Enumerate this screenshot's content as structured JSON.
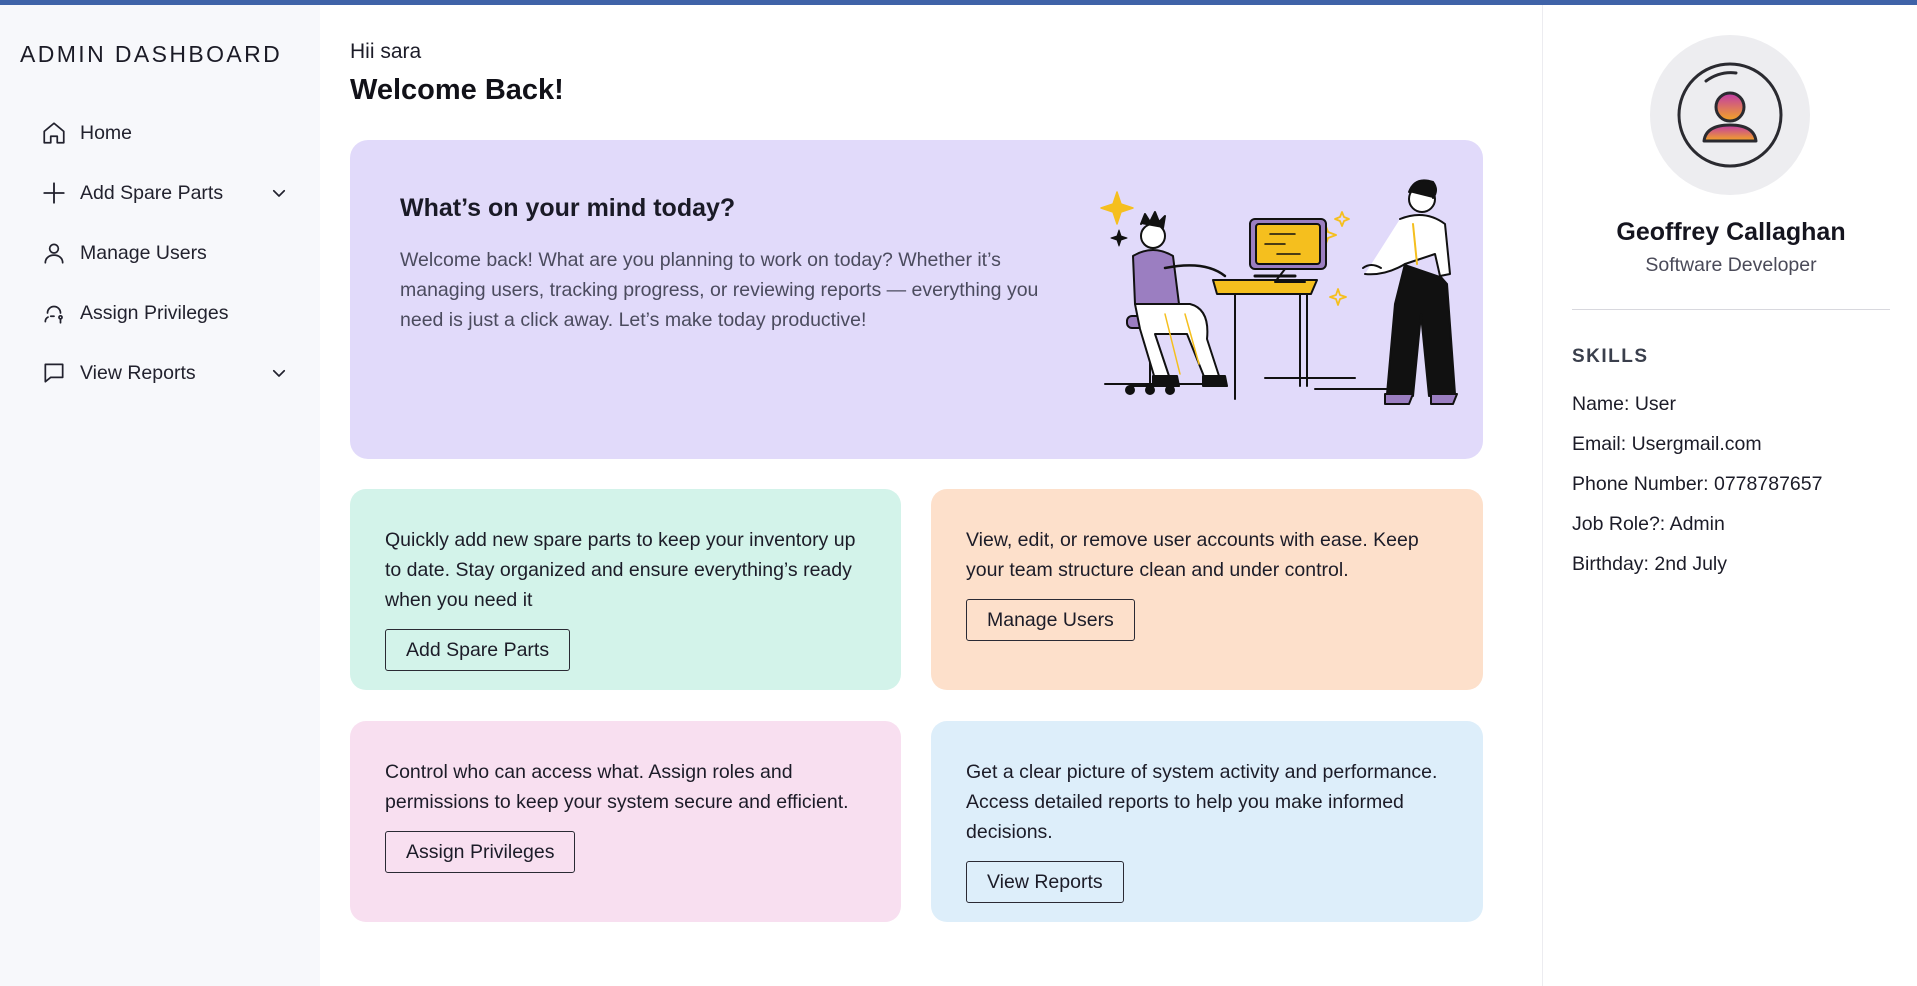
{
  "brand": "ADMIN DASHBOARD",
  "nav": [
    {
      "label": "Home",
      "icon": "home-icon"
    },
    {
      "label": "Add Spare Parts",
      "icon": "plus-icon",
      "expandable": true
    },
    {
      "label": "Manage Users",
      "icon": "user-icon"
    },
    {
      "label": "Assign Privileges",
      "icon": "key-user-icon"
    },
    {
      "label": "View Reports",
      "icon": "message-icon",
      "expandable": true
    }
  ],
  "main": {
    "greeting": "Hii sara",
    "welcome": "Welcome Back!",
    "hero": {
      "title": "What’s on your mind today?",
      "text": "Welcome back! What are you planning to work on today? Whether it’s managing users, tracking progress, or reviewing reports — everything you need is just a click away. Let’s make today productive!"
    },
    "cards": [
      {
        "text": "Quickly add new spare parts to keep your inventory up to date. Stay organized and ensure everything’s ready when you need it",
        "button": "Add Spare Parts",
        "color": "#d3f3ea"
      },
      {
        "text": "View, edit, or remove user accounts with ease. Keep your team structure clean and under control.",
        "button": "Manage Users",
        "color": "#fde0cb"
      },
      {
        "text": "Control who can access what. Assign roles and permissions to keep your system secure and efficient.",
        "button": "Assign Privileges",
        "color": "#f8dff0"
      },
      {
        "text": "Get a clear picture of system activity and performance. Access detailed reports to help you make informed decisions.",
        "button": "View Reports",
        "color": "#ddeefa"
      }
    ]
  },
  "profile": {
    "name": "Geoffrey Callaghan",
    "role": "Software Developer",
    "skills_heading": "SKILLS",
    "details": [
      "Name: User",
      "Email: Usergmail.com",
      "Phone Number: 0778787657",
      "Job Role?: Admin",
      "Birthday: 2nd July"
    ]
  },
  "colors": {
    "accent": "#3f63a8",
    "hero_bg": "#e1dafa",
    "illustration_yellow": "#f5bf1e",
    "illustration_purple": "#9b7ec1"
  }
}
